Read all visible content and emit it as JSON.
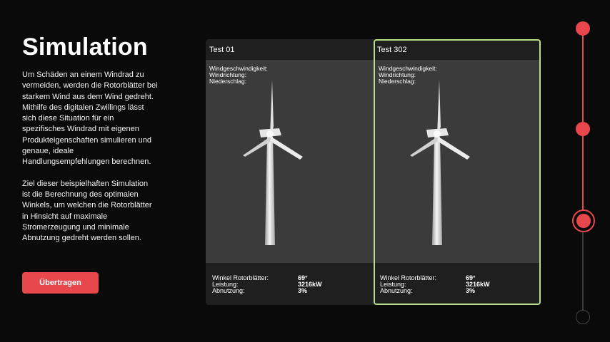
{
  "page": {
    "title": "Simulation",
    "description": [
      "Um Schäden an einem Windrad zu vermeiden, werden die Rotorblätter bei starkem Wind aus dem Wind gedreht. Mithilfe des digitalen Zwillings lässt sich diese Situation für ein spezifisches Windrad mit eigenen Produkteigenschaften simulieren und genaue, ideale Handlungsempfehlungen berechnen.",
      "Ziel dieser beispielhaften Simulation ist die Berechnung des optimalen Winkels, um welchen die Rotorblätter in Hinsicht auf maximale Stromerzeugung und minimale Abnutzung gedreht werden sollen."
    ],
    "button_label": "Übertragen"
  },
  "tests": [
    {
      "title": "Test 01",
      "conditions": [
        "Windgeschwindigkeit:",
        "Windrichtung:",
        "Niederschlag:"
      ],
      "stats": [
        {
          "label": "Winkel Rotorblätter:",
          "value": "69°"
        },
        {
          "label": "Leistung:",
          "value": "3216kW"
        },
        {
          "label": "Abnutzung:",
          "value": "3%"
        }
      ],
      "selected": false
    },
    {
      "title": "Test 302",
      "conditions": [
        "Windgeschwindigkeit:",
        "Windrichtung:",
        "Niederschlag:"
      ],
      "stats": [
        {
          "label": "Winkel Rotorblätter:",
          "value": "69°"
        },
        {
          "label": "Leistung:",
          "value": "3216kW"
        },
        {
          "label": "Abnutzung:",
          "value": "3%"
        }
      ],
      "selected": true
    }
  ],
  "timeline": {
    "steps": 4,
    "current_step": 3,
    "completed_steps": 3
  },
  "colors": {
    "accent": "#e8474c",
    "selected_border": "#b8e08a",
    "background": "#0a0a0a",
    "panel": "#1f1f1f",
    "viewport": "#3b3b3b"
  }
}
